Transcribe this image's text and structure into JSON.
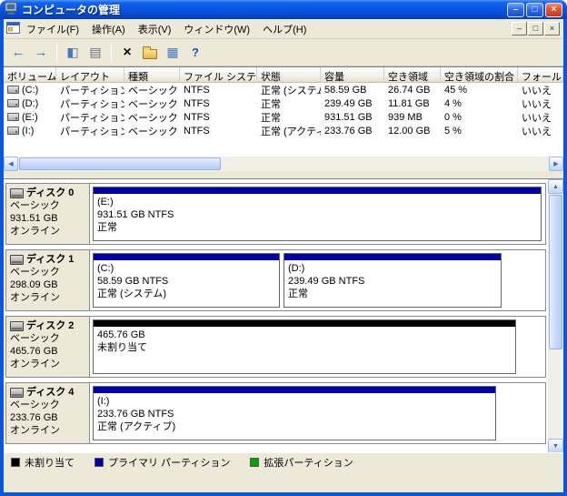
{
  "window": {
    "title": "コンピュータの管理",
    "controls": {
      "minimize": "–",
      "maximize": "□",
      "close": "×"
    }
  },
  "menubar": {
    "items": [
      "ファイル(F)",
      "操作(A)",
      "表示(V)",
      "ウィンドウ(W)",
      "ヘルプ(H)"
    ],
    "mdi": {
      "minimize": "–",
      "restore": "□",
      "close": "×"
    }
  },
  "toolbar": {
    "icons": [
      {
        "name": "back-icon",
        "glyph": "←"
      },
      {
        "name": "forward-icon",
        "glyph": "→"
      },
      {
        "name": "show-console-tree-icon",
        "glyph": "◧"
      },
      {
        "name": "properties-icon",
        "glyph": "▤"
      },
      {
        "name": "delete-icon",
        "glyph": "×"
      },
      {
        "name": "open-folder-icon",
        "glyph": ""
      },
      {
        "name": "views-icon",
        "glyph": "▦"
      },
      {
        "name": "help-icon",
        "glyph": "?"
      }
    ]
  },
  "volume_table": {
    "columns": [
      "ボリューム",
      "レイアウト",
      "種類",
      "ファイル システム",
      "状態",
      "容量",
      "空き領域",
      "空き領域の割合",
      "フォール"
    ],
    "rows": [
      [
        "(C:)",
        "パーティション",
        "ベーシック",
        "NTFS",
        "正常 (システム)",
        "58.59 GB",
        "26.74 GB",
        "45 %",
        "いいえ"
      ],
      [
        "(D:)",
        "パーティション",
        "ベーシック",
        "NTFS",
        "正常",
        "239.49 GB",
        "11.81 GB",
        "4 %",
        "いいえ"
      ],
      [
        "(E:)",
        "パーティション",
        "ベーシック",
        "NTFS",
        "正常",
        "931.51 GB",
        "939 MB",
        "0 %",
        "いいえ"
      ],
      [
        "(I:)",
        "パーティション",
        "ベーシック",
        "NTFS",
        "正常 (アクティブ)",
        "233.76 GB",
        "12.00 GB",
        "5 %",
        "いいえ"
      ]
    ]
  },
  "disk_pane": {
    "disks": [
      {
        "name": "ディスク 0",
        "type": "ベーシック",
        "size": "931.51 GB",
        "status": "オンライン",
        "partitions": [
          {
            "label": "(E:)",
            "info": "931.51 GB NTFS",
            "status": "正常",
            "color": "#0000A8"
          }
        ]
      },
      {
        "name": "ディスク 1",
        "type": "ベーシック",
        "size": "298.09 GB",
        "status": "オンライン",
        "partitions": [
          {
            "label": "(C:)",
            "info": "58.59 GB NTFS",
            "status": "正常 (システム)",
            "color": "#0000A8"
          },
          {
            "label": "(D:)",
            "info": "239.49 GB NTFS",
            "status": "正常",
            "color": "#0000A8"
          }
        ]
      },
      {
        "name": "ディスク 2",
        "type": "ベーシック",
        "size": "465.76 GB",
        "status": "オンライン",
        "partitions": [
          {
            "label": "465.76 GB",
            "info": "未割り当て",
            "status": "",
            "color": "#000000"
          }
        ]
      },
      {
        "name": "ディスク 4",
        "type": "ベーシック",
        "size": "233.76 GB",
        "status": "オンライン",
        "partitions": [
          {
            "label": "(I:)",
            "info": "233.76 GB NTFS",
            "status": "正常 (アクティブ)",
            "color": "#0000A8"
          }
        ]
      }
    ]
  },
  "legend": {
    "items": [
      {
        "label": "未割り当て",
        "color": "#000000"
      },
      {
        "label": "プライマリ パーティション",
        "color": "#0000A8"
      },
      {
        "label": "拡張パーティション",
        "color": "#00A400"
      }
    ]
  },
  "scrollbar": {
    "up": "▲",
    "down": "▼",
    "left": "◀",
    "right": "▶"
  }
}
